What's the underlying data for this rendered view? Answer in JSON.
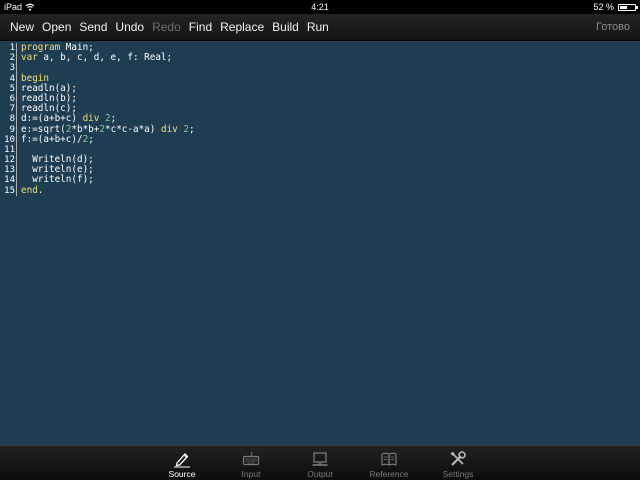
{
  "status_bar": {
    "device": "iPad",
    "time": "4:21",
    "battery": "52 %",
    "battery_level": 0.52
  },
  "toolbar": {
    "buttons": [
      {
        "label": "New",
        "enabled": true
      },
      {
        "label": "Open",
        "enabled": true
      },
      {
        "label": "Send",
        "enabled": true
      },
      {
        "label": "Undo",
        "enabled": true
      },
      {
        "label": "Redo",
        "enabled": false
      },
      {
        "label": "Find",
        "enabled": true
      },
      {
        "label": "Replace",
        "enabled": true
      },
      {
        "label": "Build",
        "enabled": true
      },
      {
        "label": "Run",
        "enabled": true
      }
    ],
    "done_label": "Готово"
  },
  "editor": {
    "line_numbers": [
      "1",
      "2",
      "3",
      "4",
      "5",
      "6",
      "7",
      "8",
      "9",
      "10",
      "11",
      "12",
      "13",
      "14",
      "15"
    ],
    "lines": [
      [
        {
          "t": "program",
          "c": "kw"
        },
        {
          "t": " Main;",
          "c": "tx"
        }
      ],
      [
        {
          "t": "var",
          "c": "kw"
        },
        {
          "t": " a, b, c, d, e, f: Real;",
          "c": "tx"
        }
      ],
      [],
      [
        {
          "t": "begin",
          "c": "kw"
        }
      ],
      [
        {
          "t": "readln(a);",
          "c": "tx"
        }
      ],
      [
        {
          "t": "readln(b);",
          "c": "tx"
        }
      ],
      [
        {
          "t": "readln(c);",
          "c": "tx"
        }
      ],
      [
        {
          "t": "d:=(a+b+c) ",
          "c": "tx"
        },
        {
          "t": "div",
          "c": "kw"
        },
        {
          "t": " ",
          "c": "tx"
        },
        {
          "t": "2",
          "c": "nm"
        },
        {
          "t": ";",
          "c": "tx"
        }
      ],
      [
        {
          "t": "e:=sqrt(",
          "c": "tx"
        },
        {
          "t": "2",
          "c": "nm"
        },
        {
          "t": "*b*b+",
          "c": "tx"
        },
        {
          "t": "2",
          "c": "nm"
        },
        {
          "t": "*c*c-a*a) ",
          "c": "tx"
        },
        {
          "t": "div",
          "c": "kw"
        },
        {
          "t": " ",
          "c": "tx"
        },
        {
          "t": "2",
          "c": "nm"
        },
        {
          "t": ";",
          "c": "tx"
        }
      ],
      [
        {
          "t": "f:=(a+b+c)/",
          "c": "tx"
        },
        {
          "t": "2",
          "c": "nm"
        },
        {
          "t": ";",
          "c": "tx"
        }
      ],
      [],
      [
        {
          "t": "  Writeln(d);",
          "c": "tx"
        }
      ],
      [
        {
          "t": "  writeln(e);",
          "c": "tx"
        }
      ],
      [
        {
          "t": "  writeln(f);",
          "c": "tx"
        }
      ],
      [
        {
          "t": "end",
          "c": "kw"
        },
        {
          "t": ".",
          "c": "tx"
        }
      ]
    ]
  },
  "tab_bar": {
    "tabs": [
      {
        "label": "Source",
        "icon": "pencil-icon",
        "active": true
      },
      {
        "label": "Input",
        "icon": "keyboard-icon",
        "active": false
      },
      {
        "label": "Output",
        "icon": "monitor-icon",
        "active": false
      },
      {
        "label": "Reference",
        "icon": "book-icon",
        "active": false
      },
      {
        "label": "Settings",
        "icon": "tools-icon",
        "active": false
      }
    ]
  }
}
